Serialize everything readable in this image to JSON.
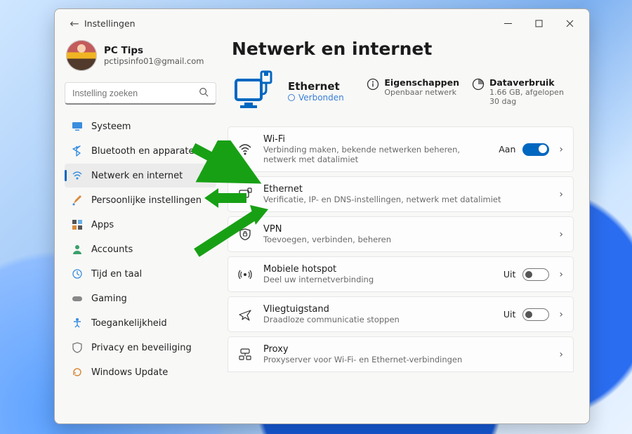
{
  "window": {
    "title": "Instellingen"
  },
  "profile": {
    "name": "PC Tips",
    "email": "pctipsinfo01@gmail.com"
  },
  "search": {
    "placeholder": "Instelling zoeken"
  },
  "nav": [
    {
      "label": "Systeem"
    },
    {
      "label": "Bluetooth en apparaten"
    },
    {
      "label": "Netwerk en internet"
    },
    {
      "label": "Persoonlijke instellingen"
    },
    {
      "label": "Apps"
    },
    {
      "label": "Accounts"
    },
    {
      "label": "Tijd en taal"
    },
    {
      "label": "Gaming"
    },
    {
      "label": "Toegankelijkheid"
    },
    {
      "label": "Privacy en beveiliging"
    },
    {
      "label": "Windows Update"
    }
  ],
  "nav_active_index": 2,
  "main_title": "Netwerk en internet",
  "hero": {
    "title": "Ethernet",
    "status": "Verbonden"
  },
  "stats": {
    "props_label": "Eigenschappen",
    "props_sub": "Openbaar netwerk",
    "data_label": "Dataverbruik",
    "data_sub": "1.66 GB, afgelopen 30 dag"
  },
  "cards": {
    "wifi": {
      "title": "Wi-Fi",
      "sub": "Verbinding maken, bekende netwerken beheren, netwerk met datalimiet",
      "state_label": "Aan",
      "on": true
    },
    "eth": {
      "title": "Ethernet",
      "sub": "Verificatie, IP- en DNS-instellingen, netwerk met datalimiet"
    },
    "vpn": {
      "title": "VPN",
      "sub": "Toevoegen, verbinden, beheren"
    },
    "hotspot": {
      "title": "Mobiele hotspot",
      "sub": "Deel uw internetverbinding",
      "state_label": "Uit",
      "on": false
    },
    "air": {
      "title": "Vliegtuigstand",
      "sub": "Draadloze communicatie stoppen",
      "state_label": "Uit",
      "on": false
    },
    "proxy": {
      "title": "Proxy",
      "sub": "Proxyserver voor Wi-Fi- en Ethernet-verbindingen"
    }
  }
}
